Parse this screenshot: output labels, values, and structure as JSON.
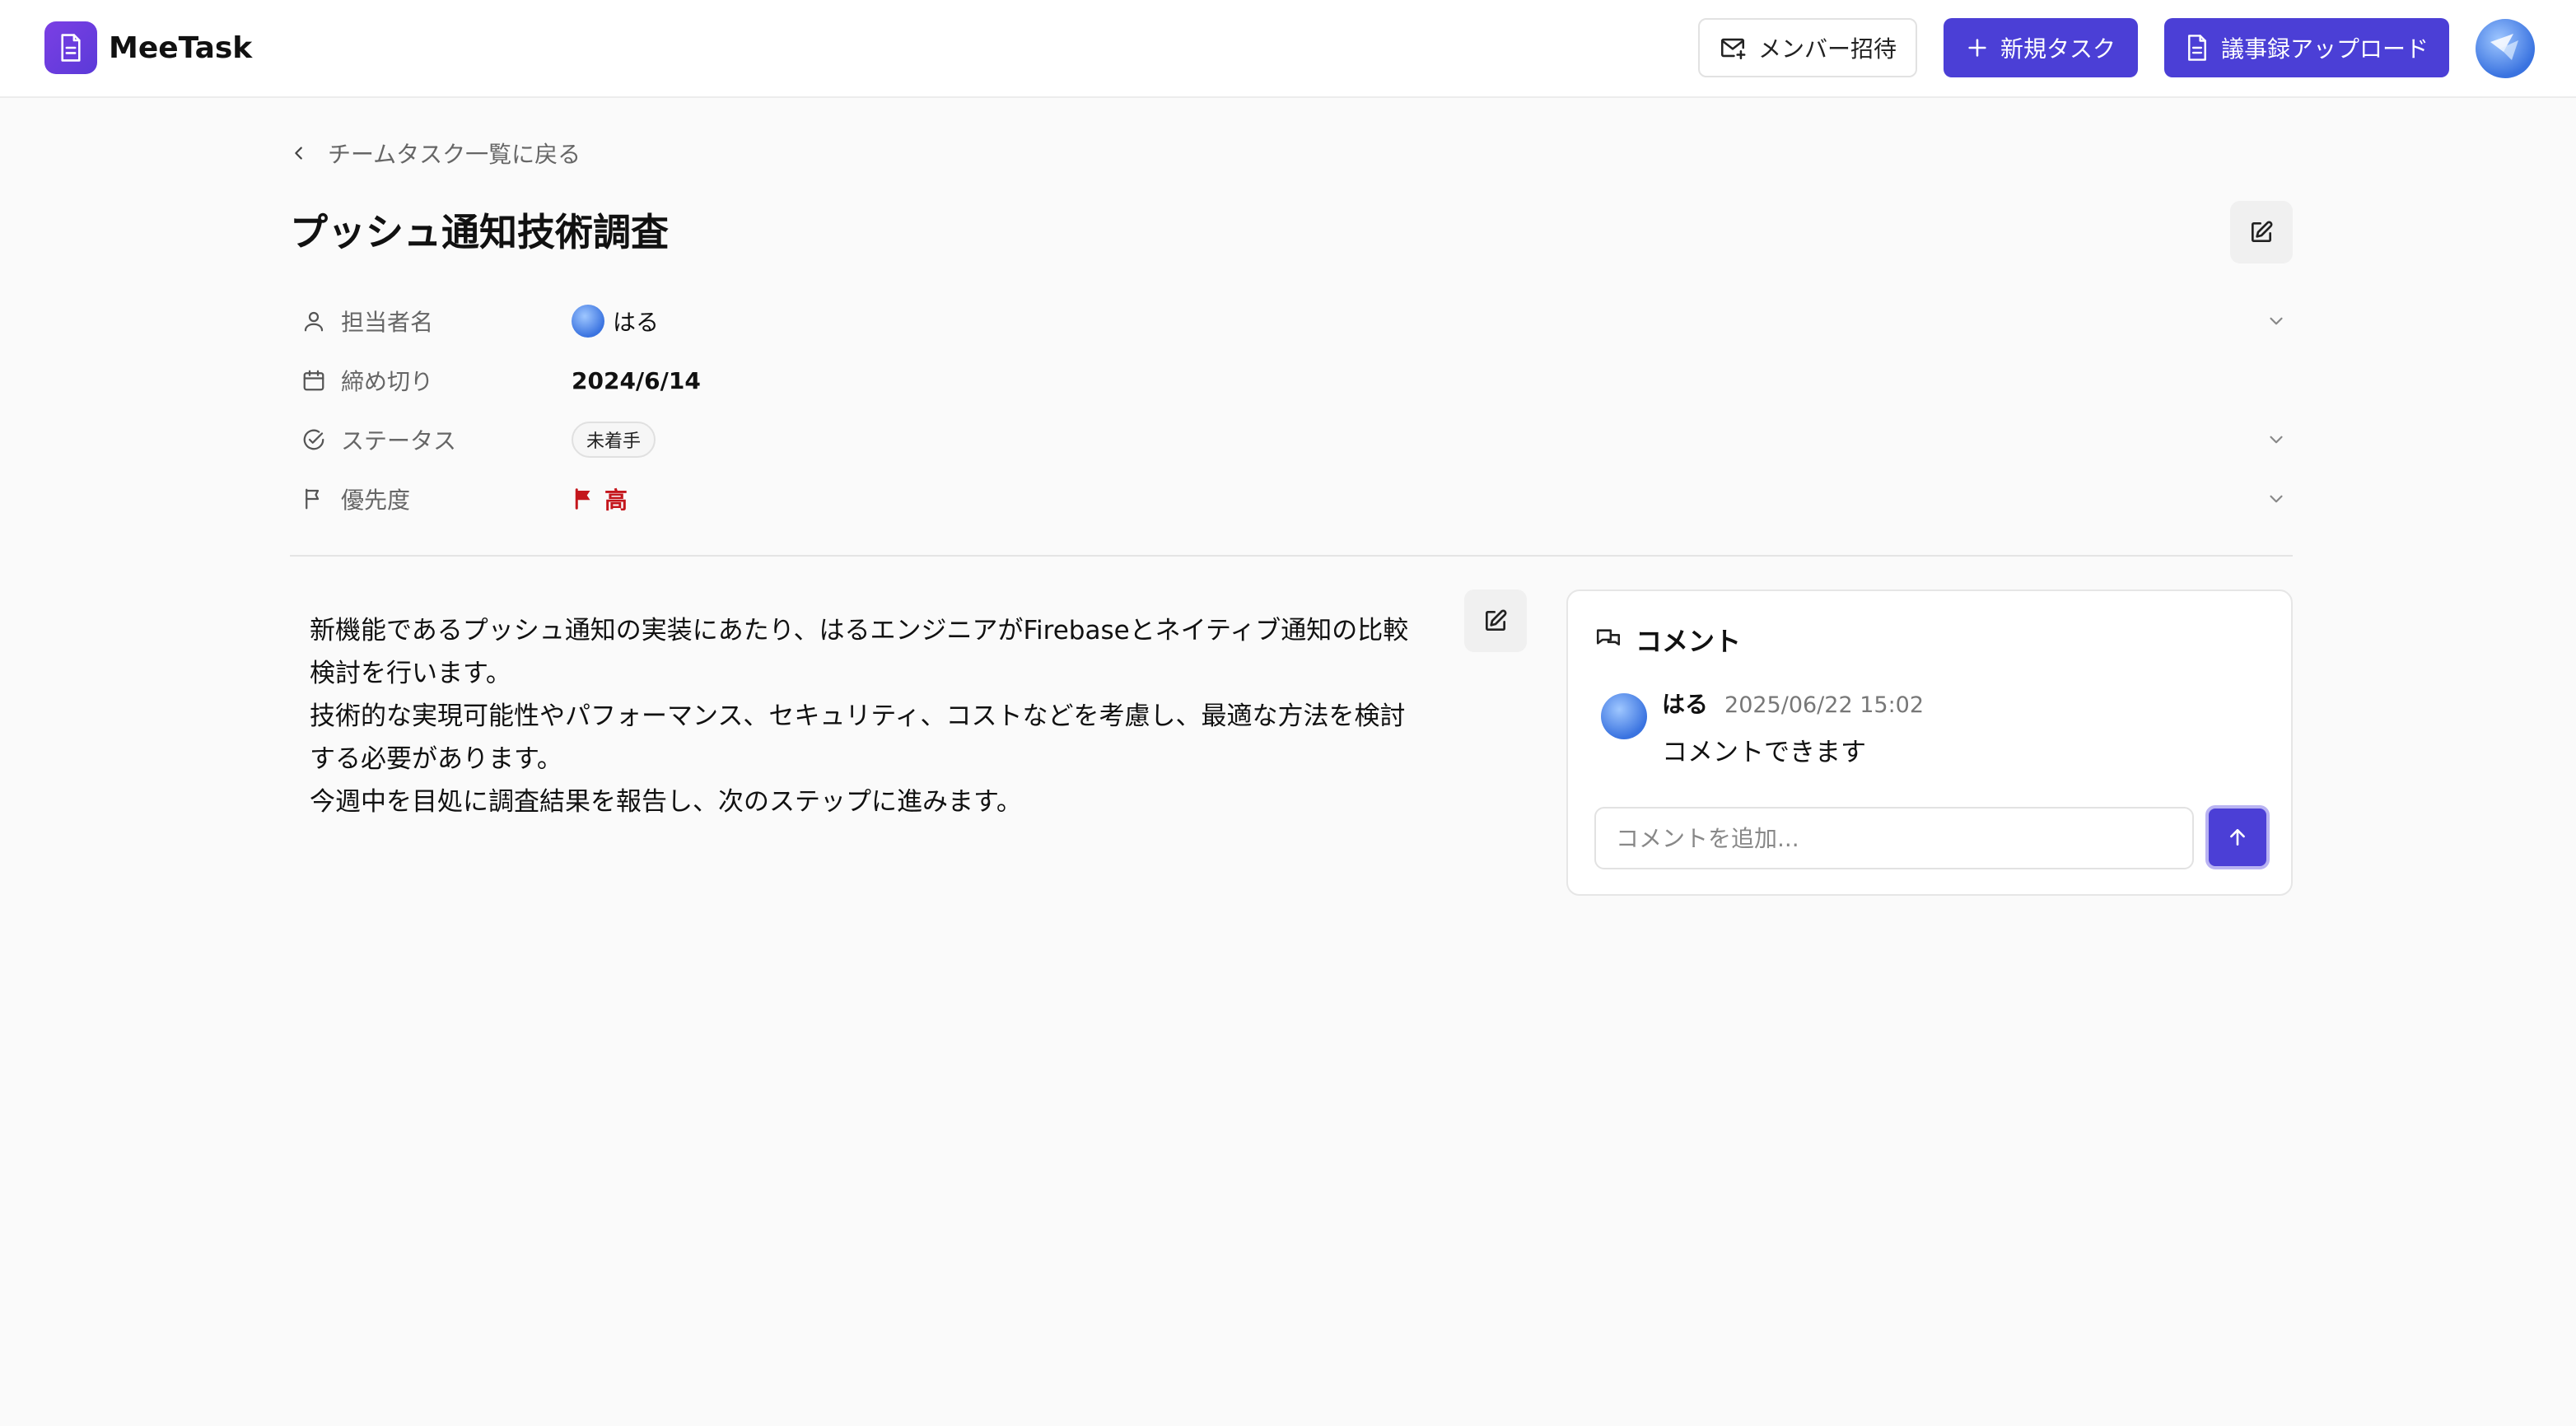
{
  "app": {
    "name": "MeeTask"
  },
  "header": {
    "invite_label": "メンバー招待",
    "new_task_label": "新規タスク",
    "upload_minutes_label": "議事録アップロード"
  },
  "nav": {
    "back_label": "チームタスク一覧に戻る"
  },
  "task": {
    "title": "プッシュ通知技術調査",
    "properties": {
      "assignee": {
        "label": "担当者名",
        "value": "はる"
      },
      "deadline": {
        "label": "締め切り",
        "value": "2024/6/14"
      },
      "status": {
        "label": "ステータス",
        "value": "未着手"
      },
      "priority": {
        "label": "優先度",
        "value": "高",
        "color": "#c4161c"
      }
    },
    "description": [
      "新機能であるプッシュ通知の実装にあたり、はるエンジニアがFirebaseとネイティブ通知の比較検討を行います。",
      "技術的な実現可能性やパフォーマンス、セキュリティ、コストなどを考慮し、最適な方法を検討する必要があります。",
      "今週中を目処に調査結果を報告し、次のステップに進みます。"
    ]
  },
  "comments": {
    "title": "コメント",
    "items": [
      {
        "author": "はる",
        "time": "2025/06/22 15:02",
        "text": "コメントできます"
      }
    ],
    "input_placeholder": "コメントを追加..."
  },
  "colors": {
    "primary": "#4b3fd6",
    "logo": "#6a3de0",
    "priority_high": "#c4161c"
  },
  "icons": {
    "logo": "document-icon",
    "invite": "mail-plus-icon",
    "new_task": "plus-icon",
    "upload": "document-icon",
    "back": "chevron-left-icon",
    "edit": "edit-icon",
    "assignee": "user-icon",
    "deadline": "calendar-icon",
    "status": "check-circle-icon",
    "priority": "flag-icon",
    "comments": "chat-bubbles-icon",
    "send": "arrow-up-icon",
    "expand": "chevron-down-icon"
  }
}
